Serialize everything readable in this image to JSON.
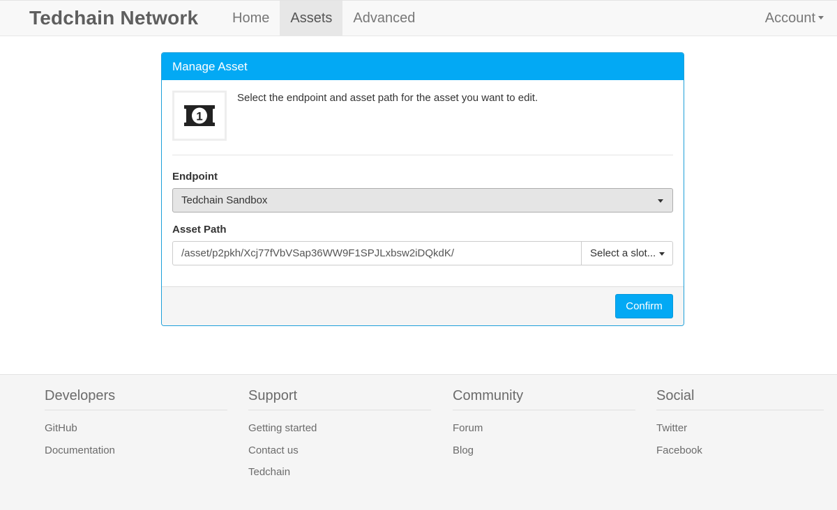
{
  "navbar": {
    "brand": "Tedchain Network",
    "links": [
      {
        "label": "Home",
        "active": false
      },
      {
        "label": "Assets",
        "active": true
      },
      {
        "label": "Advanced",
        "active": false
      }
    ],
    "account_label": "Account"
  },
  "panel": {
    "title": "Manage Asset",
    "icon": "money-bill-icon",
    "icon_digit": "1",
    "intro_text": "Select the endpoint and asset path for the asset you want to edit.",
    "endpoint_label": "Endpoint",
    "endpoint_value": "Tedchain Sandbox",
    "asset_path_label": "Asset Path",
    "asset_path_value": "/asset/p2pkh/Xcj77fVbVSap36WW9F1SPJLxbsw2iDQkdK/",
    "slot_button_label": "Select a slot...",
    "confirm_label": "Confirm"
  },
  "footer": {
    "columns": [
      {
        "title": "Developers",
        "links": [
          "GitHub",
          "Documentation"
        ]
      },
      {
        "title": "Support",
        "links": [
          "Getting started",
          "Contact us",
          "Tedchain"
        ]
      },
      {
        "title": "Community",
        "links": [
          "Forum",
          "Blog"
        ]
      },
      {
        "title": "Social",
        "links": [
          "Twitter",
          "Facebook"
        ]
      }
    ]
  },
  "colors": {
    "accent": "#03a9f4",
    "navbar_bg": "#f8f8f8",
    "footer_bg": "#f5f5f5"
  }
}
